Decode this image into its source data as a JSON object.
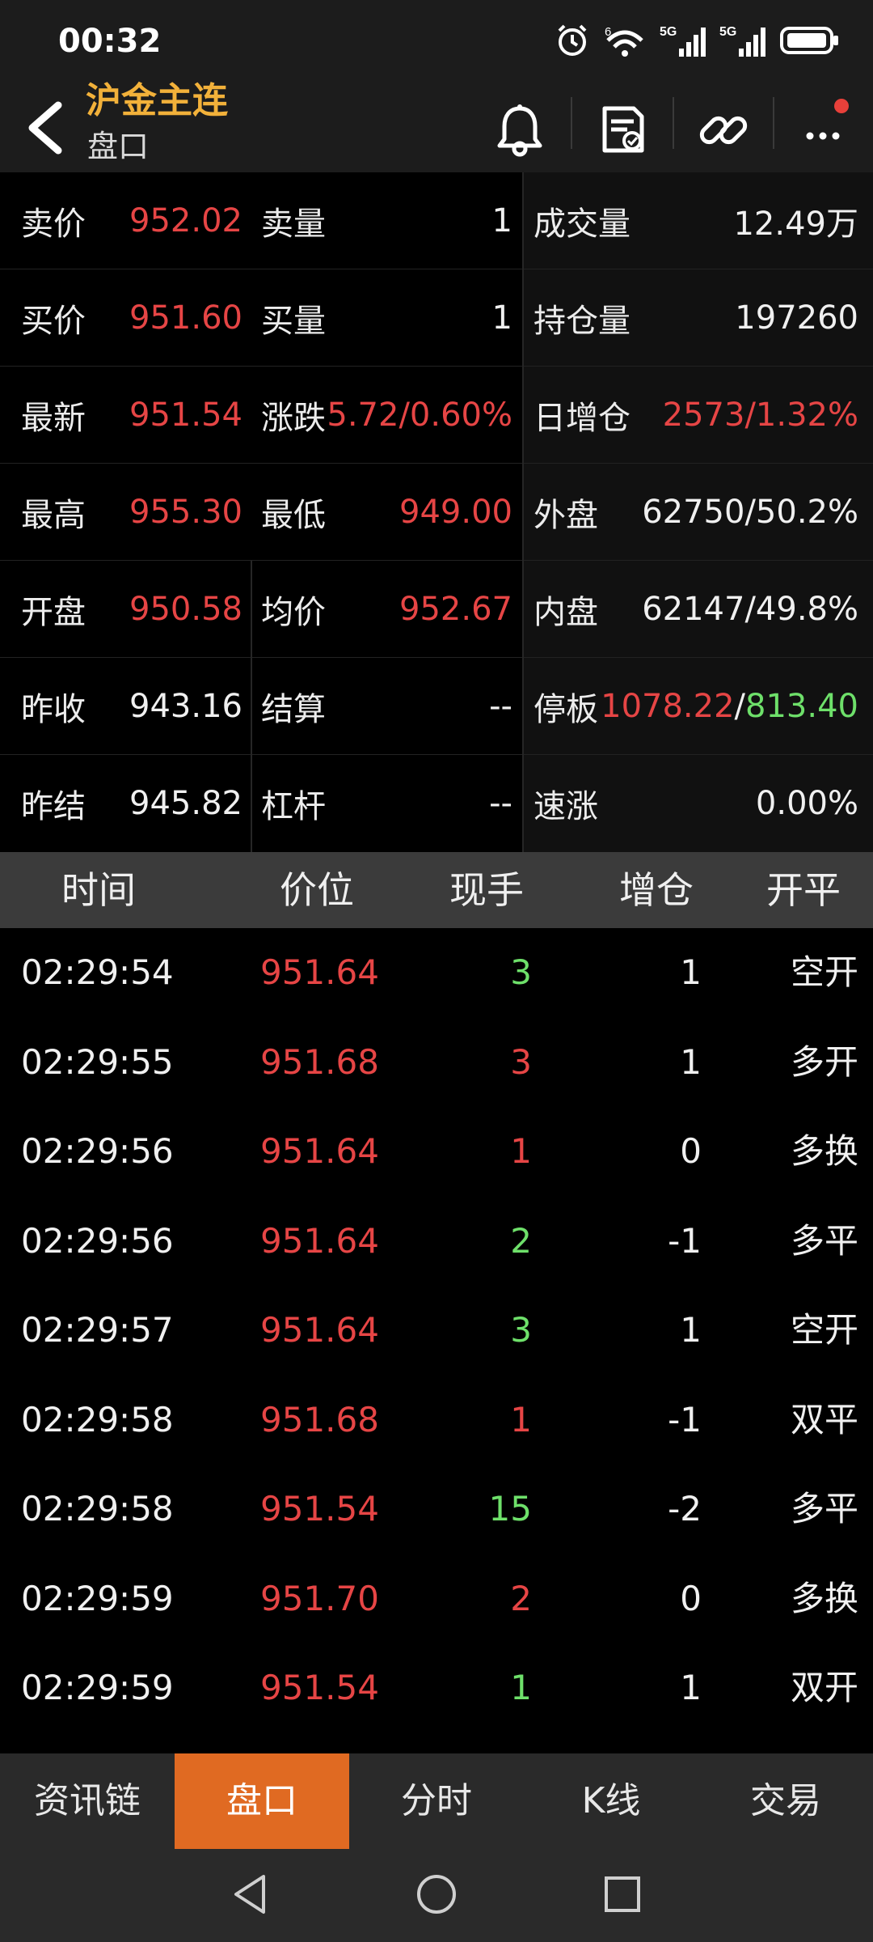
{
  "status_bar": {
    "time": "00:32",
    "icons": [
      "alarm-icon",
      "wifi-icon",
      "signal-5g-icon",
      "signal-5g-icon",
      "battery-icon"
    ],
    "network_labels": [
      "6",
      "5G",
      "5G"
    ]
  },
  "header": {
    "title": "沪金主连",
    "subtitle": "盘口",
    "icons": [
      "back-icon",
      "bell-icon",
      "document-icon",
      "link-icon",
      "more-icon"
    ]
  },
  "quote": {
    "sell_price_label": "卖价",
    "sell_price": "952.02",
    "sell_vol_label": "卖量",
    "sell_vol": "1",
    "volume_label": "成交量",
    "volume": "12.49万",
    "buy_price_label": "买价",
    "buy_price": "951.60",
    "buy_vol_label": "买量",
    "buy_vol": "1",
    "open_interest_label": "持仓量",
    "open_interest": "197260",
    "last_label": "最新",
    "last": "951.54",
    "change_label": "涨跌",
    "change": "5.72/0.60%",
    "daily_oi_label": "日增仓",
    "daily_oi": "2573/1.32%",
    "high_label": "最高",
    "high": "955.30",
    "low_label": "最低",
    "low": "949.00",
    "outer_label": "外盘",
    "outer": "62750/50.2%",
    "open_label": "开盘",
    "open": "950.58",
    "avg_label": "均价",
    "avg": "952.67",
    "inner_label": "内盘",
    "inner": "62147/49.8%",
    "prev_close_label": "昨收",
    "prev_close": "943.16",
    "settle_label": "结算",
    "settle": "--",
    "limit_label": "停板",
    "limit_up": "1078.22",
    "limit_sep": "/",
    "limit_down": "813.40",
    "prev_settle_label": "昨结",
    "prev_settle": "945.82",
    "leverage_label": "杠杆",
    "leverage": "--",
    "speed_label": "速涨",
    "speed": "0.00%"
  },
  "trades": {
    "headers": [
      "时间",
      "价位",
      "现手",
      "增仓",
      "开平"
    ],
    "rows": [
      {
        "time": "02:29:54",
        "price": "951.64",
        "vol": "3",
        "vol_color": "#6ee06a",
        "oi": "1",
        "type": "空开"
      },
      {
        "time": "02:29:55",
        "price": "951.68",
        "vol": "3",
        "vol_color": "#e64545",
        "oi": "1",
        "type": "多开"
      },
      {
        "time": "02:29:56",
        "price": "951.64",
        "vol": "1",
        "vol_color": "#e64545",
        "oi": "0",
        "type": "多换"
      },
      {
        "time": "02:29:56",
        "price": "951.64",
        "vol": "2",
        "vol_color": "#6ee06a",
        "oi": "-1",
        "type": "多平"
      },
      {
        "time": "02:29:57",
        "price": "951.64",
        "vol": "3",
        "vol_color": "#6ee06a",
        "oi": "1",
        "type": "空开"
      },
      {
        "time": "02:29:58",
        "price": "951.68",
        "vol": "1",
        "vol_color": "#e64545",
        "oi": "-1",
        "type": "双平"
      },
      {
        "time": "02:29:58",
        "price": "951.54",
        "vol": "15",
        "vol_color": "#6ee06a",
        "oi": "-2",
        "type": "多平"
      },
      {
        "time": "02:29:59",
        "price": "951.70",
        "vol": "2",
        "vol_color": "#e64545",
        "oi": "0",
        "type": "多换"
      },
      {
        "time": "02:29:59",
        "price": "951.54",
        "vol": "1",
        "vol_color": "#6ee06a",
        "oi": "1",
        "type": "双开"
      }
    ]
  },
  "tabs": {
    "items": [
      "资讯链",
      "盘口",
      "分时",
      "K线",
      "交易"
    ],
    "active": "盘口"
  },
  "navbar": {
    "icons": [
      "back-triangle-icon",
      "home-circle-icon",
      "recents-square-icon"
    ]
  },
  "colors": {
    "accent": "#f2b13a",
    "up": "#e64545",
    "down": "#6ee06a",
    "active_tab": "#e06a22"
  }
}
